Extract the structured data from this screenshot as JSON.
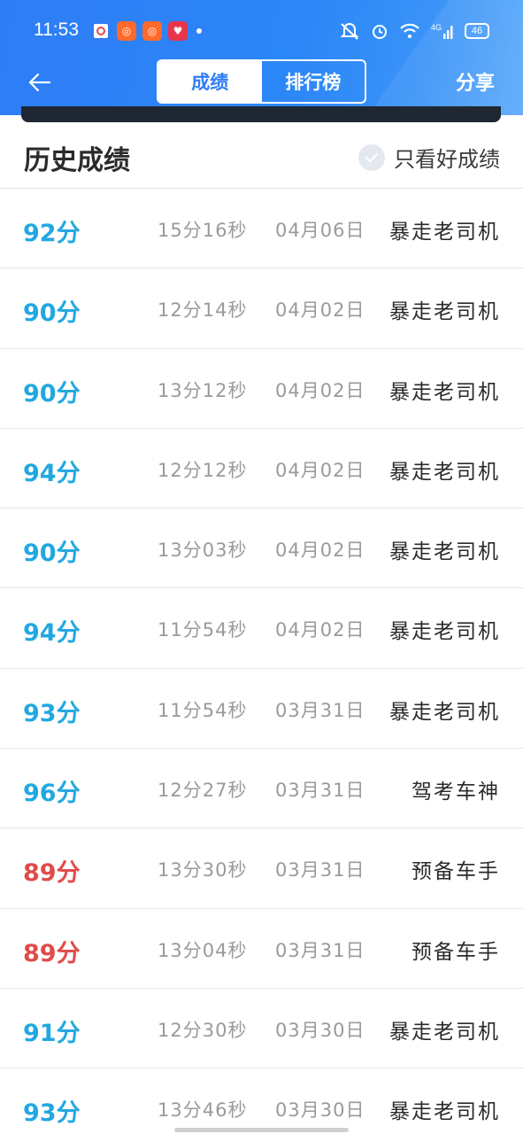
{
  "status_bar": {
    "time": "11:53",
    "battery": "46",
    "network": "4G"
  },
  "nav": {
    "tabs": [
      {
        "label": "成绩",
        "active": true
      },
      {
        "label": "排行榜",
        "active": false
      }
    ],
    "share_label": "分享"
  },
  "section": {
    "title": "历史成绩",
    "filter_label": "只看好成绩"
  },
  "colors": {
    "brand": "#2f7df6",
    "pass": "#22a8e0",
    "fail": "#e04b4b"
  },
  "records": [
    {
      "score": "92分",
      "duration": "15分16秒",
      "date": "04月06日",
      "title": "暴走老司机",
      "pass": true
    },
    {
      "score": "90分",
      "duration": "12分14秒",
      "date": "04月02日",
      "title": "暴走老司机",
      "pass": true
    },
    {
      "score": "90分",
      "duration": "13分12秒",
      "date": "04月02日",
      "title": "暴走老司机",
      "pass": true
    },
    {
      "score": "94分",
      "duration": "12分12秒",
      "date": "04月02日",
      "title": "暴走老司机",
      "pass": true
    },
    {
      "score": "90分",
      "duration": "13分03秒",
      "date": "04月02日",
      "title": "暴走老司机",
      "pass": true
    },
    {
      "score": "94分",
      "duration": "11分54秒",
      "date": "04月02日",
      "title": "暴走老司机",
      "pass": true
    },
    {
      "score": "93分",
      "duration": "11分54秒",
      "date": "03月31日",
      "title": "暴走老司机",
      "pass": true
    },
    {
      "score": "96分",
      "duration": "12分27秒",
      "date": "03月31日",
      "title": "驾考车神",
      "pass": true
    },
    {
      "score": "89分",
      "duration": "13分30秒",
      "date": "03月31日",
      "title": "预备车手",
      "pass": false
    },
    {
      "score": "89分",
      "duration": "13分04秒",
      "date": "03月31日",
      "title": "预备车手",
      "pass": false
    },
    {
      "score": "91分",
      "duration": "12分30秒",
      "date": "03月30日",
      "title": "暴走老司机",
      "pass": true
    },
    {
      "score": "93分",
      "duration": "13分46秒",
      "date": "03月30日",
      "title": "暴走老司机",
      "pass": true
    }
  ]
}
